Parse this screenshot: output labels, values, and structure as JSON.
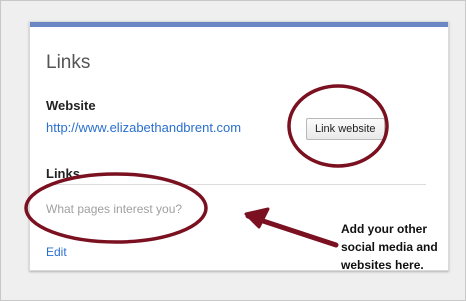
{
  "card": {
    "title": "Links",
    "accent_color": "#6b86c4"
  },
  "website": {
    "label": "Website",
    "url": "http://www.elizabethandbrent.com",
    "button_label": "Link website"
  },
  "links": {
    "label": "Links",
    "placeholder": "What pages interest you?",
    "edit_label": "Edit"
  },
  "annotation": {
    "lines": [
      "Add your other",
      "social media and",
      "websites here."
    ],
    "ink_color": "#7a1020",
    "icons": [
      "ellipse-highlight",
      "arrow-left"
    ]
  }
}
